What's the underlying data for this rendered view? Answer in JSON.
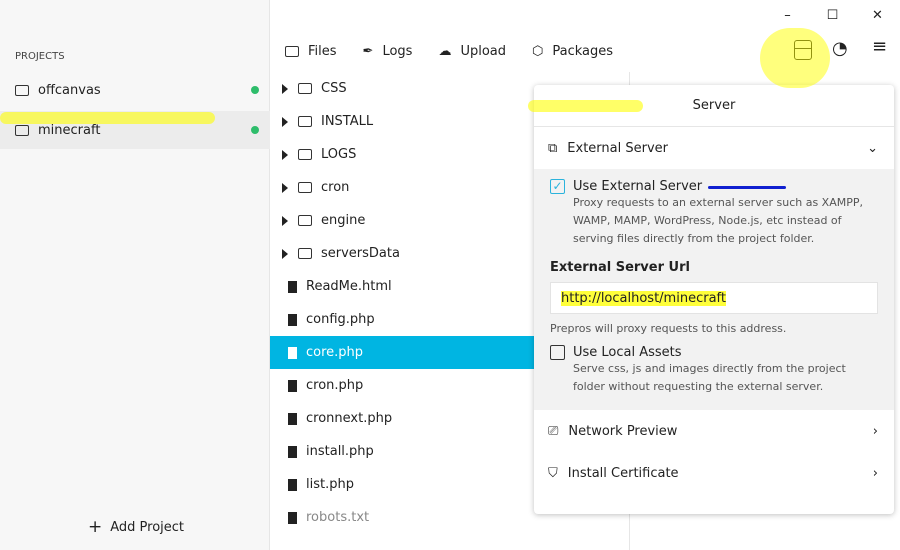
{
  "sidebar": {
    "heading": "PROJECTS",
    "projects": [
      {
        "name": "offcanvas"
      },
      {
        "name": "minecraft"
      }
    ],
    "add_label": "Add Project"
  },
  "tabs": [
    {
      "label": "Files"
    },
    {
      "label": "Logs"
    },
    {
      "label": "Upload"
    },
    {
      "label": "Packages"
    }
  ],
  "files": [
    {
      "name": "CSS",
      "type": "folder"
    },
    {
      "name": "INSTALL",
      "type": "folder"
    },
    {
      "name": "LOGS",
      "type": "folder"
    },
    {
      "name": "cron",
      "type": "folder"
    },
    {
      "name": "engine",
      "type": "folder"
    },
    {
      "name": "serversData",
      "type": "folder"
    },
    {
      "name": "ReadMe.html",
      "type": "file"
    },
    {
      "name": "config.php",
      "type": "file"
    },
    {
      "name": "core.php",
      "type": "file",
      "selected": true
    },
    {
      "name": "cron.php",
      "type": "file"
    },
    {
      "name": "cronnext.php",
      "type": "file"
    },
    {
      "name": "install.php",
      "type": "file"
    },
    {
      "name": "list.php",
      "type": "file"
    },
    {
      "name": "robots.txt",
      "type": "file"
    }
  ],
  "popover": {
    "title": "Server",
    "external_server": "External Server",
    "use_external": "Use External Server",
    "use_external_desc": "Proxy requests to an external server such as XAMPP, WAMP, MAMP, WordPress, Node.js, etc instead of serving files directly from the project folder.",
    "url_label": "External Server Url",
    "url_value": "http://localhost/minecraft",
    "url_hint": "Prepros will proxy requests to this address.",
    "use_local": "Use Local Assets",
    "use_local_desc": "Serve css, js and images directly from the project folder without requesting the external server.",
    "network_preview": "Network Preview",
    "install_cert": "Install Certificate"
  },
  "colors": {
    "accent": "#00b5e2",
    "status": "#2ebd6b",
    "highlight": "#ffff00"
  }
}
